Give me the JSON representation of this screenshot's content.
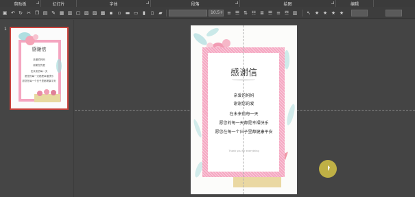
{
  "ribbon": {
    "groups": [
      {
        "label": "剪贴板"
      },
      {
        "label": "幻灯片"
      },
      {
        "label": "字体"
      },
      {
        "label": "段落"
      },
      {
        "label": "绘图"
      },
      {
        "label": "编辑"
      }
    ],
    "font_size_value": "10.5+"
  },
  "thumbnails": [
    {
      "number": "1"
    }
  ],
  "slide": {
    "title": "感谢信",
    "lines": [
      "亲爱的妈妈",
      "谢谢您的爱",
      "在未来的每一天",
      "愿您的每一天都是幸福快乐",
      "愿您在每一个日子里都健康平安"
    ],
    "small_text": "Thank you for everything"
  },
  "colors": {
    "frame_pink": "#f5a7c1",
    "thumb_border": "#c8423c",
    "cursor_highlight": "#e8d446"
  }
}
